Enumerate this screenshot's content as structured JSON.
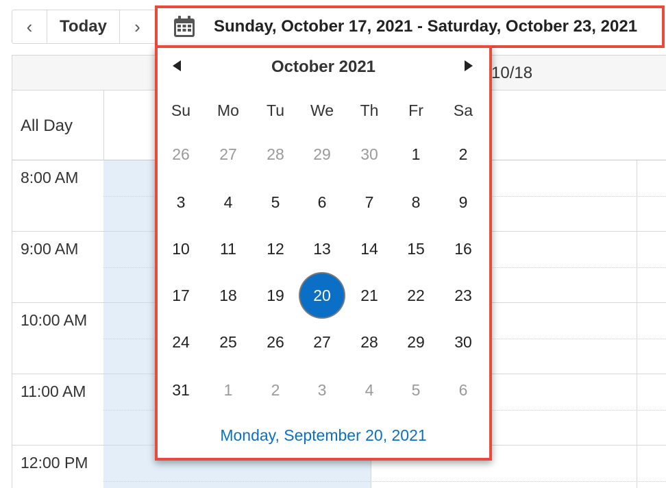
{
  "toolbar": {
    "prev_label": "‹",
    "today_label": "Today",
    "next_label": "›",
    "range_label": "Sunday, October 17, 2021 - Saturday, October 23, 2021"
  },
  "calendar_view": {
    "column_header": "n 10/18",
    "all_day_label": "All Day",
    "time_slots": [
      "8:00 AM",
      "9:00 AM",
      "10:00 AM",
      "11:00 AM",
      "12:00 PM"
    ]
  },
  "datepicker": {
    "month_title": "October 2021",
    "weekdays": [
      "Su",
      "Mo",
      "Tu",
      "We",
      "Th",
      "Fr",
      "Sa"
    ],
    "weeks": [
      [
        {
          "d": "26",
          "other": true
        },
        {
          "d": "27",
          "other": true
        },
        {
          "d": "28",
          "other": true
        },
        {
          "d": "29",
          "other": true
        },
        {
          "d": "30",
          "other": true
        },
        {
          "d": "1"
        },
        {
          "d": "2"
        }
      ],
      [
        {
          "d": "3"
        },
        {
          "d": "4"
        },
        {
          "d": "5"
        },
        {
          "d": "6"
        },
        {
          "d": "7"
        },
        {
          "d": "8"
        },
        {
          "d": "9"
        }
      ],
      [
        {
          "d": "10"
        },
        {
          "d": "11"
        },
        {
          "d": "12"
        },
        {
          "d": "13"
        },
        {
          "d": "14"
        },
        {
          "d": "15"
        },
        {
          "d": "16"
        }
      ],
      [
        {
          "d": "17"
        },
        {
          "d": "18"
        },
        {
          "d": "19"
        },
        {
          "d": "20",
          "selected": true
        },
        {
          "d": "21"
        },
        {
          "d": "22"
        },
        {
          "d": "23"
        }
      ],
      [
        {
          "d": "24"
        },
        {
          "d": "25"
        },
        {
          "d": "26"
        },
        {
          "d": "27"
        },
        {
          "d": "28"
        },
        {
          "d": "29"
        },
        {
          "d": "30"
        }
      ],
      [
        {
          "d": "31"
        },
        {
          "d": "1",
          "other": true
        },
        {
          "d": "2",
          "other": true
        },
        {
          "d": "3",
          "other": true
        },
        {
          "d": "4",
          "other": true
        },
        {
          "d": "5",
          "other": true
        },
        {
          "d": "6",
          "other": true
        }
      ]
    ],
    "today_link": "Monday, September 20, 2021"
  },
  "colors": {
    "highlight_border": "#e84a3b",
    "selected_day": "#0b6fc6",
    "today_column": "#e3eef9",
    "link": "#0b6fc6"
  }
}
